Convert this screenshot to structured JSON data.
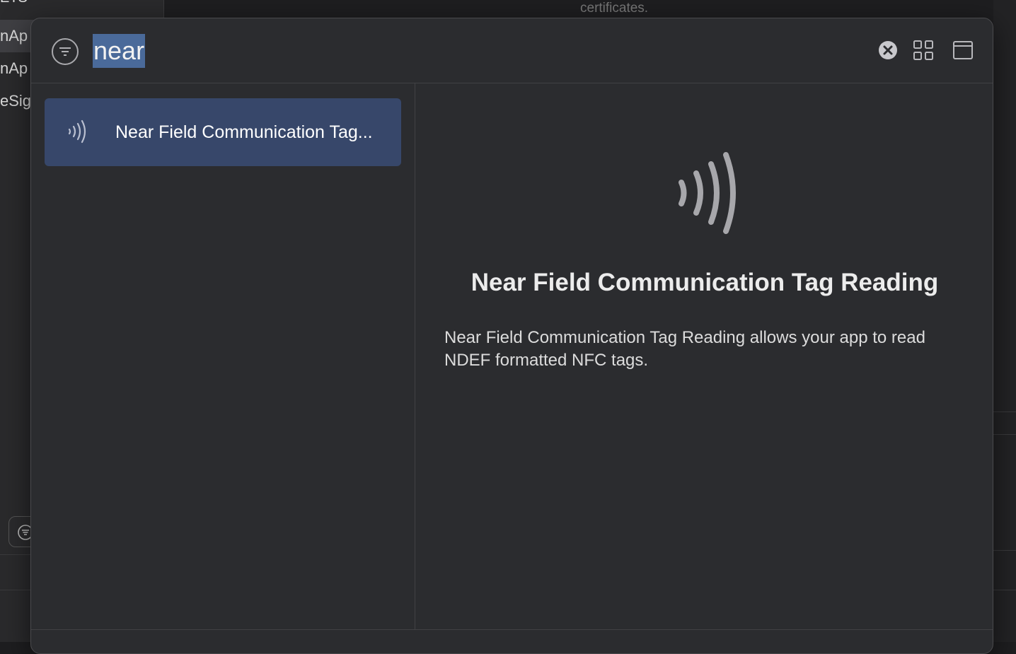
{
  "background": {
    "left_rows": [
      "nAp",
      "nAp",
      "eSig"
    ],
    "top_text": "certificates."
  },
  "search": {
    "query": "near"
  },
  "toolbar": {
    "icons": [
      "filter-icon",
      "clear-icon",
      "grid-view-icon",
      "window-icon"
    ]
  },
  "results": {
    "items": [
      {
        "label": "Near Field Communication Tag...",
        "icon": "nfc-icon",
        "selected": true
      }
    ]
  },
  "detail": {
    "title": "Near Field Communication Tag Reading",
    "description": "Near Field Communication Tag Reading allows your app to read NDEF formatted NFC tags.",
    "icon": "nfc-icon"
  },
  "colors": {
    "selection": "#37476a",
    "search_highlight": "#4a6a9a",
    "sheet_bg": "#2b2c2f"
  }
}
